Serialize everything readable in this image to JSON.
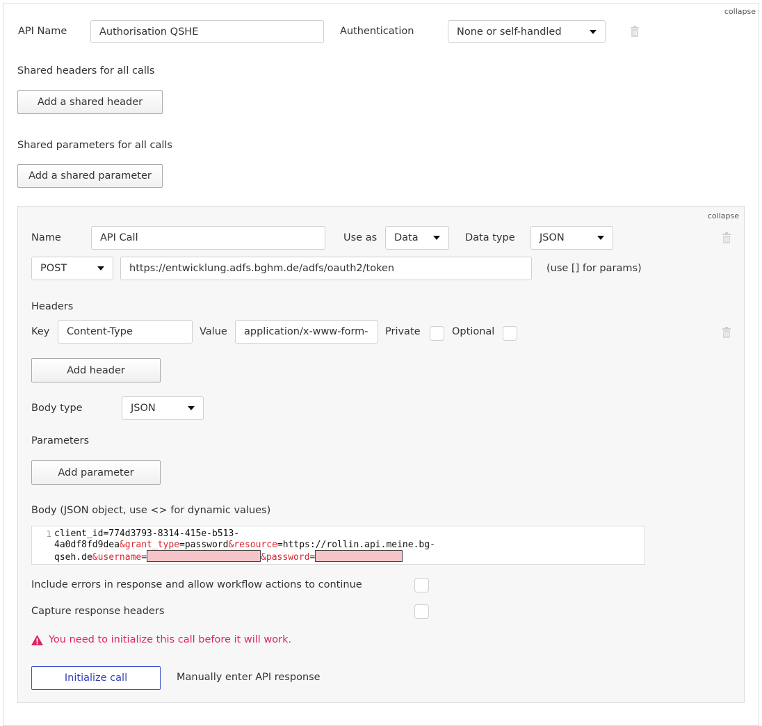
{
  "outer": {
    "collapse_label": "collapse",
    "api_name_label": "API Name",
    "api_name_value": "Authorisation QSHE",
    "authentication_label": "Authentication",
    "authentication_value": "None or self-handled",
    "shared_headers_label": "Shared headers for all calls",
    "add_shared_header": "Add a shared header",
    "shared_params_label": "Shared parameters for all calls",
    "add_shared_parameter": "Add a shared parameter"
  },
  "call": {
    "collapse_label": "collapse",
    "name_label": "Name",
    "name_value": "API Call",
    "use_as_label": "Use as",
    "use_as_value": "Data",
    "data_type_label": "Data type",
    "data_type_value": "JSON",
    "method_value": "POST",
    "url_value": "https://entwicklung.adfs.bghm.de/adfs/oauth2/token",
    "url_hint": "(use [] for params)",
    "headers_label": "Headers",
    "key_label": "Key",
    "key_value": "Content-Type",
    "value_label": "Value",
    "value_value": "application/x-www-form-",
    "private_label": "Private",
    "optional_label": "Optional",
    "add_header": "Add header",
    "body_type_label": "Body type",
    "body_type_value": "JSON",
    "parameters_label": "Parameters",
    "add_parameter": "Add parameter",
    "body_label": "Body (JSON object, use <> for dynamic values)",
    "code": {
      "line_number": "1",
      "l1": "client_id=774d3793-8314-415e-b513-",
      "l2a": "4a0df8fd9dea",
      "l2b": "&grant_type",
      "l2c": "=password",
      "l2d": "&resource",
      "l2e": "=https://rollin.api.meine.bg-",
      "l3a": "qseh.de",
      "l3b": "&username",
      "l3c": "=",
      "l3d": "&password",
      "l3e": "="
    },
    "include_errors_label": "Include errors in response and allow workflow actions to continue",
    "capture_headers_label": "Capture response headers",
    "warning_text": "You need to initialize this call before it will work.",
    "initialize_button": "Initialize call",
    "manual_entry_link": "Manually enter API response"
  },
  "colors": {
    "warning": "#e0245e",
    "primary_border": "#3b50cf",
    "code_token": "#d7262f",
    "redaction": "#f4c4c8"
  }
}
